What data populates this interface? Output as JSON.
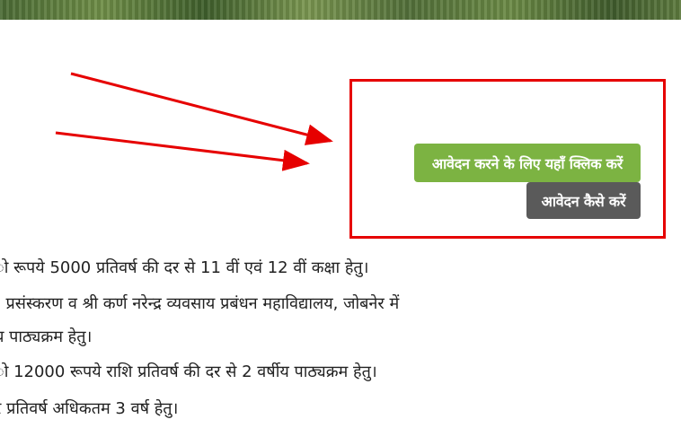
{
  "buttons": {
    "apply_label": "आवेदन करने के लिए यहाँ क्लिक करें",
    "how_to_apply_label": "आवेदन कैसे करें"
  },
  "text_lines": [
    "ो रूपये 5000 प्रतिवर्ष की दर से 11 वीं एवं 12 वीं कक्षा हेतु।",
    "। प्रसंस्करण व श्री कर्ण नरेन्द्र व्यवसाय प्रबंधन महाविद्यालय, जोबनेर में",
    "य पाठ्यक्रम हेतु।",
    "ो 12000 रूपये राशि प्रतिवर्ष की दर से 2 वर्षीय पाठ्यक्रम हेतु।",
    "र प्रतिवर्ष अधिकतम 3 वर्ष हेतु।"
  ],
  "colors": {
    "apply_button": "#7cb342",
    "how_button": "#5a5a5a",
    "annotation": "#e60000"
  }
}
